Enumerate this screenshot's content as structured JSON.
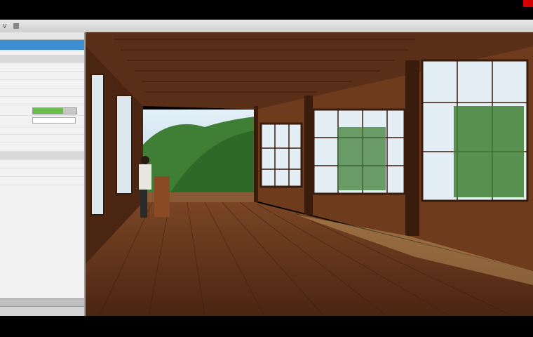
{
  "window": {
    "title_items": [
      "V",
      "",
      "",
      ""
    ]
  },
  "panel": {
    "rows": [
      {
        "label": "",
        "type": "selected"
      },
      {
        "label": "",
        "type": "group"
      },
      {
        "label": "",
        "type": "row"
      },
      {
        "label": "",
        "type": "group"
      },
      {
        "label": "",
        "type": "row"
      },
      {
        "label": "",
        "type": "row"
      },
      {
        "label": "",
        "type": "row"
      },
      {
        "label": "",
        "type": "row"
      }
    ],
    "slider_level": 0.7,
    "field_value": ""
  },
  "colors": {
    "selection": "#3d8fd1",
    "slider_fill": "#6abf4b",
    "floor": "#6b3a1f",
    "forest": "#3f7f35",
    "sky": "#cfe4f2"
  }
}
